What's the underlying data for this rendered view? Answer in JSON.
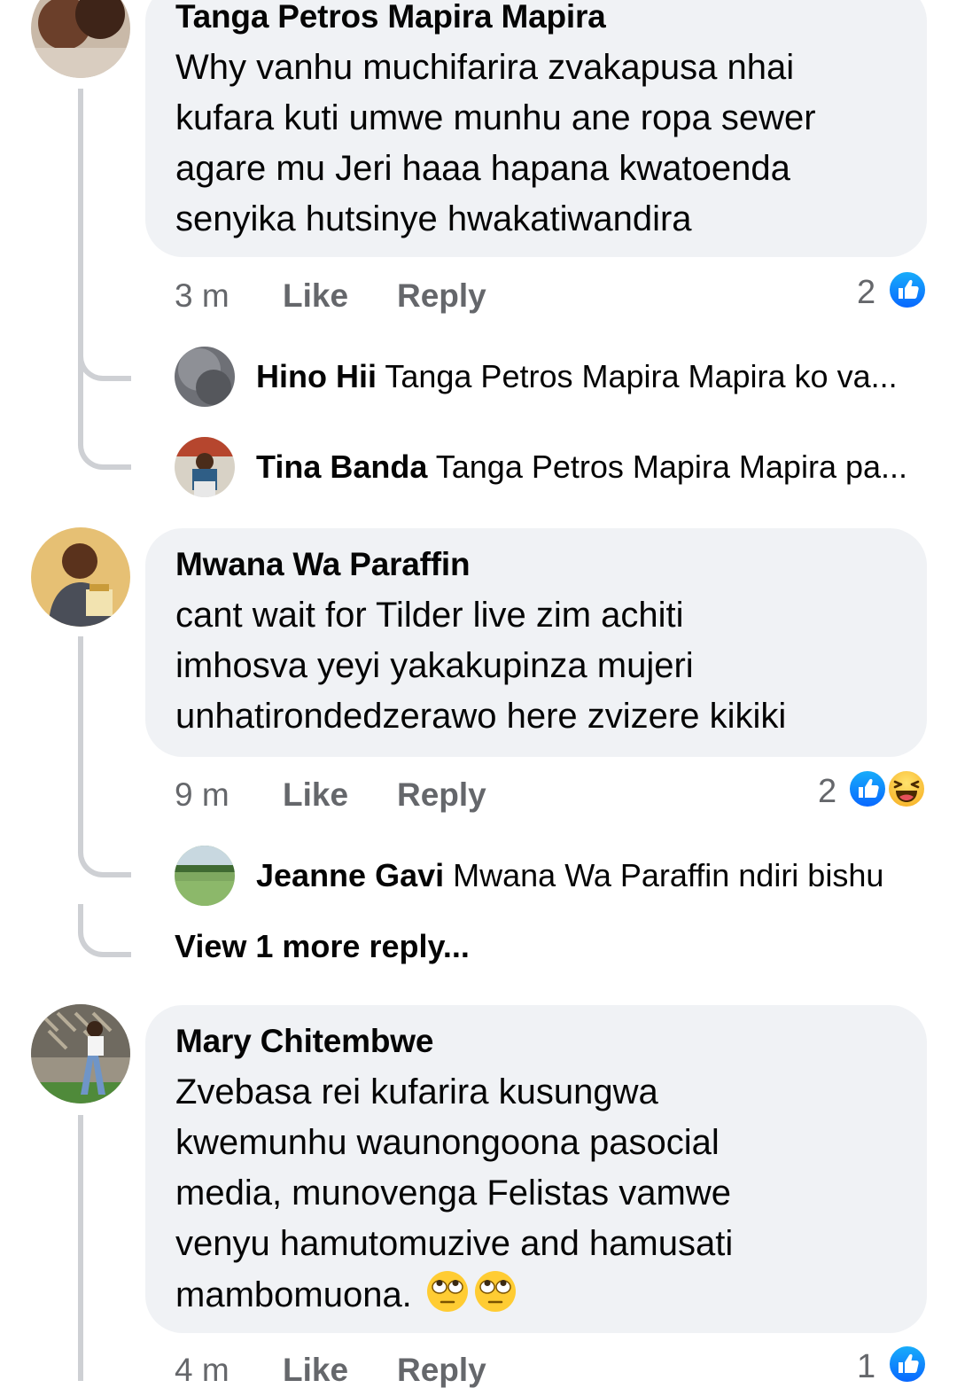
{
  "comments": [
    {
      "author": "Tanga Petros Mapira Mapira",
      "text_lines": [
        "Why vanhu muchifarira zvakapusa nhai",
        "kufara kuti umwe munhu ane ropa sewer",
        "agare mu Jeri haaa hapana kwatoenda",
        "senyika hutsinye hwakatiwandira"
      ],
      "time": "3 m",
      "like_label": "Like",
      "reply_label": "Reply",
      "reaction_count": "2",
      "reactions": [
        "like-icon"
      ],
      "replies": [
        {
          "author": "Hino Hii",
          "preview": "Tanga Petros Mapira Mapira ko va..."
        },
        {
          "author": "Tina Banda",
          "preview": "Tanga Petros Mapira Mapira pa..."
        }
      ]
    },
    {
      "author": "Mwana Wa Paraffin",
      "text_lines": [
        "cant wait for Tilder live zim achiti",
        "imhosva yeyi yakakupinza mujeri",
        "unhatirondedzerawo here zvizere kikiki"
      ],
      "time": "9 m",
      "like_label": "Like",
      "reply_label": "Reply",
      "reaction_count": "2",
      "reactions": [
        "like-icon",
        "haha-icon"
      ],
      "replies": [
        {
          "author": "Jeanne Gavi",
          "preview": "Mwana Wa Paraffin ndiri bishu"
        }
      ],
      "view_more": "View 1 more reply..."
    },
    {
      "author": "Mary Chitembwe",
      "text_lines": [
        "Zvebasa rei kufarira kusungwa",
        "kwemunhu waunongoona pasocial",
        "media, munovenga Felistas vamwe",
        "venyu hamutomuzive and hamusati",
        "mambomuona."
      ],
      "emojis": [
        "eye-roll-emoji",
        "eye-roll-emoji"
      ],
      "time": "4 m",
      "like_label": "Like",
      "reply_label": "Reply",
      "reaction_count": "1",
      "reactions": [
        "like-icon"
      ]
    }
  ],
  "colors": {
    "bubble": "#f0f2f5",
    "meta_text": "#65676b",
    "like_blue": "#1877f2",
    "thread_line": "#ced0d4"
  }
}
